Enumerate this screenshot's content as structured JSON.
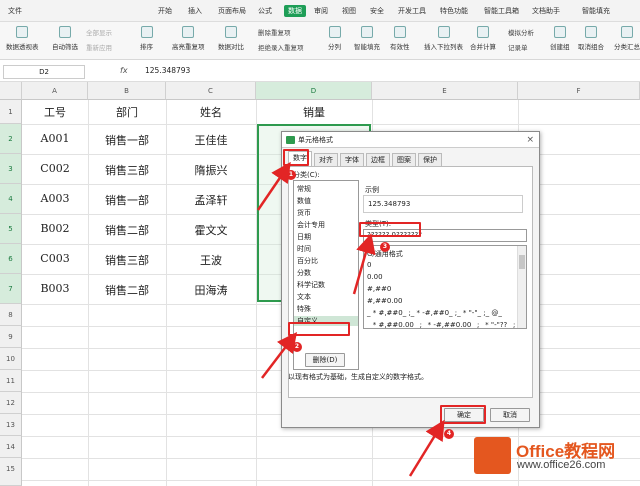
{
  "menu": {
    "file": "文件",
    "tabs": [
      "开始",
      "插入",
      "页面布局",
      "公式",
      "数据",
      "审阅",
      "视图",
      "安全",
      "开发工具",
      "特色功能",
      "智能工具箱",
      "文档助手"
    ],
    "active_tab": "数据",
    "smart_fill": "智能填充"
  },
  "ribbon": {
    "pivot": "数据透视表",
    "autofilter": "自动筛选",
    "show_all": "全部显示",
    "reapply": "重新应用",
    "sort": "排序",
    "highlight_dup": "高亮重复项",
    "compare": "数据对比",
    "delete_dup": "删除重复项",
    "reject_dup": "拒绝录入重复项",
    "split": "分列",
    "smart_fill": "智能填充",
    "validity": "有效性",
    "insert_dropdown": "插入下拉列表",
    "merge_calc": "合并计算",
    "simulate": "模拟分析",
    "record": "记录单",
    "create_group": "创建组",
    "ungroup": "取消组合",
    "subtotal": "分类汇总"
  },
  "formula_bar": {
    "name_box": "D2",
    "fx": "fx",
    "value": "125.348793"
  },
  "columns": [
    "A",
    "B",
    "C",
    "D",
    "E",
    "F"
  ],
  "rows": [
    "1",
    "2",
    "3",
    "4",
    "5",
    "6",
    "7",
    "8",
    "9",
    "10",
    "11",
    "12",
    "13",
    "14",
    "15"
  ],
  "headers": [
    "工号",
    "部门",
    "姓名",
    "销量"
  ],
  "table": [
    [
      "A001",
      "销售一部",
      "王佳佳"
    ],
    [
      "C002",
      "销售三部",
      "隋振兴"
    ],
    [
      "A003",
      "销售一部",
      "孟泽轩"
    ],
    [
      "B002",
      "销售二部",
      "霍文文"
    ],
    [
      "C003",
      "销售三部",
      "王波"
    ],
    [
      "B003",
      "销售二部",
      "田海涛"
    ]
  ],
  "dialog": {
    "title": "单元格格式",
    "close": "×",
    "tabs": [
      "数字",
      "对齐",
      "字体",
      "边框",
      "图案",
      "保护"
    ],
    "category_label": "分类(C):",
    "categories": [
      "常规",
      "数值",
      "货币",
      "会计专用",
      "日期",
      "时间",
      "百分比",
      "分数",
      "科学记数",
      "文本",
      "特殊",
      "自定义"
    ],
    "selected_category": "自定义",
    "sample_label": "示例",
    "sample_value": "125.348793",
    "type_label": "类型(T):",
    "type_value": "??????.0???????",
    "formats": [
      "G/通用格式",
      "0",
      "0.00",
      "#,##0",
      "#,##0.00",
      "_ * #,##0_ ;_ * -#,##0_ ;_ * \"-\"_ ;_ @_",
      "_ * #,##0.00_ ;_ * -#,##0.00_ ;_ * \"-\"??_ ;_ @_"
    ],
    "delete_btn": "删除(D)",
    "hint": "以现有格式为基础，生成自定义的数字格式。",
    "ok": "确定",
    "cancel": "取消"
  },
  "markers": [
    "1",
    "2",
    "3",
    "4"
  ],
  "watermark": {
    "brand": "Office教程网",
    "url": "www.office26.com"
  },
  "colors": {
    "accent": "#1e9e57",
    "annotation": "#e22525",
    "brand": "#e4571f"
  }
}
